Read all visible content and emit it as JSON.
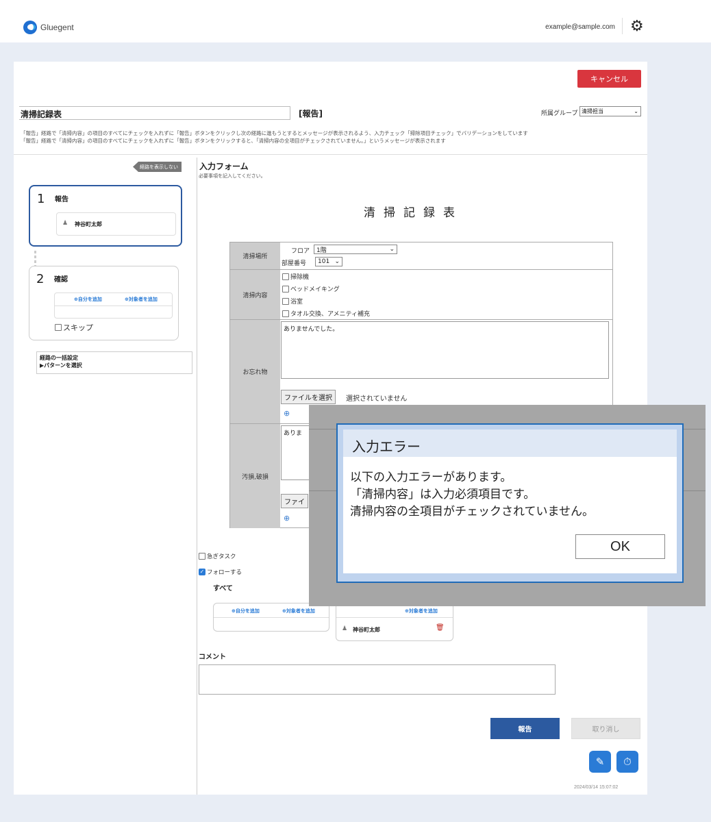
{
  "brand": {
    "name": "Gluegent"
  },
  "header": {
    "user_email": "example@sample.com",
    "settings_icon": "gear-icon"
  },
  "actions": {
    "cancel": "キャンセル",
    "report": "報告",
    "undo": "取り消し"
  },
  "document": {
    "title_value": "清掃記録表",
    "status": "[報告]",
    "group_label": "所属グループ",
    "group_value": "清掃担当",
    "description": [
      "「報告」経路で「清掃内容」の項目のすべてにチェックを入れずに「報告」ボタンをクリックし次の経路に進もうとするとメッセージが表示されるよう、入力チェック「掃除項目チェック」でバリデーションをしています",
      "「報告」経路で「清掃内容」の項目のすべてにチェックを入れずに「報告」ボタンをクリックすると、「清掃内容の全項目がチェックされていません。」というメッセージが表示されます"
    ]
  },
  "route": {
    "toggle": "経路を表示しない",
    "steps": [
      {
        "num": "1",
        "title": "報告",
        "person": "神谷町太郎"
      },
      {
        "num": "2",
        "title": "確認",
        "add_self": "自分を追加",
        "add_target": "対象者を追加",
        "skip": "スキップ"
      }
    ],
    "bulk_title": "経路の一括設定",
    "bulk_pattern": "▶パターンを選択"
  },
  "form": {
    "heading": "入力フォーム",
    "subheading": "必要事項を記入してください。",
    "doc_title": "清掃記録表",
    "place": {
      "label": "清掃場所",
      "floor_label": "フロア",
      "floor_value": "1階",
      "room_label": "部屋番号",
      "room_value": "101"
    },
    "content": {
      "label": "清掃内容",
      "options": [
        "掃除機",
        "ベッドメイキング",
        "浴室",
        "タオル交換、アメニティ補充"
      ]
    },
    "lost": {
      "label": "お忘れ物",
      "value": "ありませんでした。",
      "file_button": "ファイルを選択",
      "file_status": "選択されていません"
    },
    "damage": {
      "label": "汚損,破損",
      "value": "ありま",
      "file_button": "ファイ"
    }
  },
  "dialog": {
    "title": "入力エラー",
    "messages": [
      "以下の入力エラーがあります。",
      "「清掃内容」は入力必須項目です。",
      "清掃内容の全項目がチェックされていません。"
    ],
    "ok": "OK"
  },
  "options": {
    "urgent": "急ぎタスク",
    "follow": "フォローする",
    "all": "すべて",
    "add_self": "自分を追加",
    "add_target": "対象者を追加",
    "follower": "神谷町太郎"
  },
  "comment": {
    "label": "コメント"
  },
  "timestamp": "2024/03/14 15:07:02"
}
